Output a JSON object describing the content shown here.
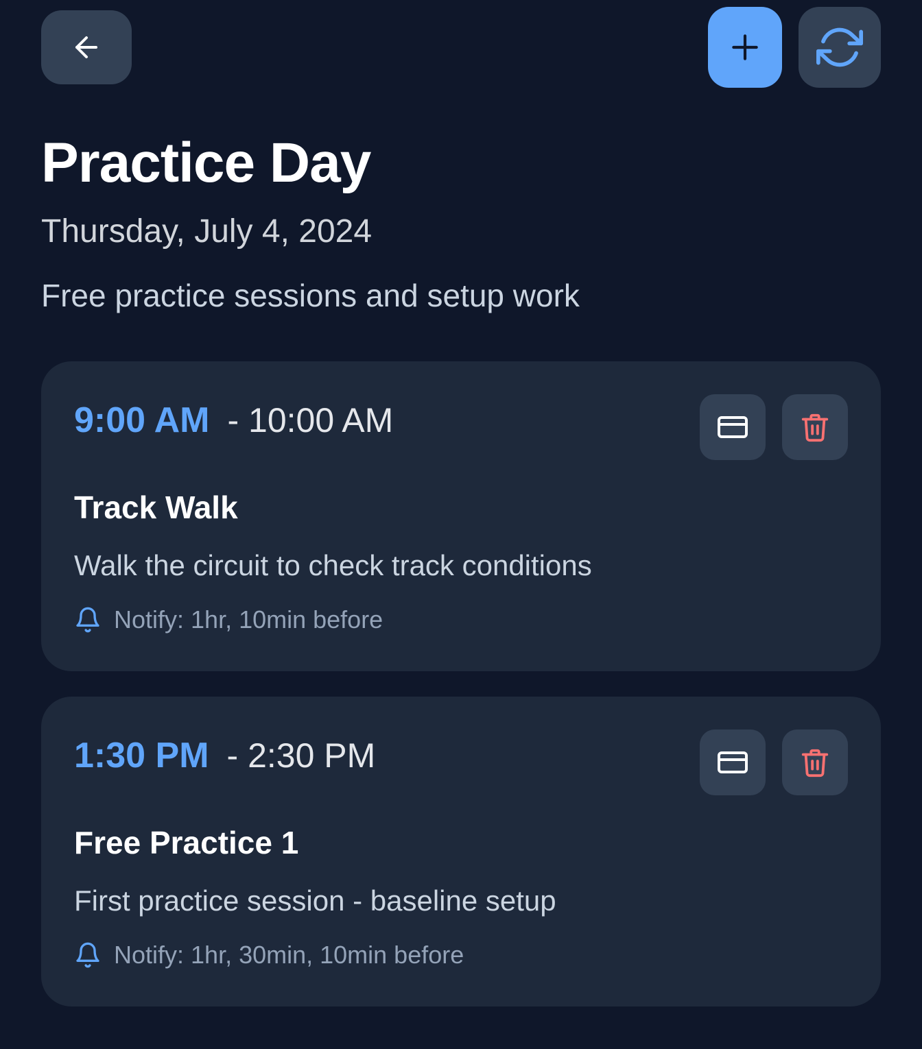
{
  "header": {
    "back_icon": "arrow-left-icon",
    "add_icon": "plus-icon",
    "refresh_icon": "refresh-icon"
  },
  "page": {
    "title": "Practice Day",
    "date": "Thursday, July 4, 2024",
    "description": "Free practice sessions and setup work"
  },
  "events": [
    {
      "start": "9:00 AM",
      "end": "- 10:00 AM",
      "title": "Track Walk",
      "description": "Walk the circuit to check track conditions",
      "notify": "Notify: 1hr, 10min before"
    },
    {
      "start": "1:30 PM",
      "end": "- 2:30 PM",
      "title": "Free Practice 1",
      "description": "First practice session - baseline setup",
      "notify": "Notify: 1hr, 30min, 10min before"
    }
  ],
  "colors": {
    "background": "#0f172a",
    "card": "#1e293b",
    "button": "#334155",
    "accent": "#60a5fa",
    "danger": "#f87171"
  }
}
